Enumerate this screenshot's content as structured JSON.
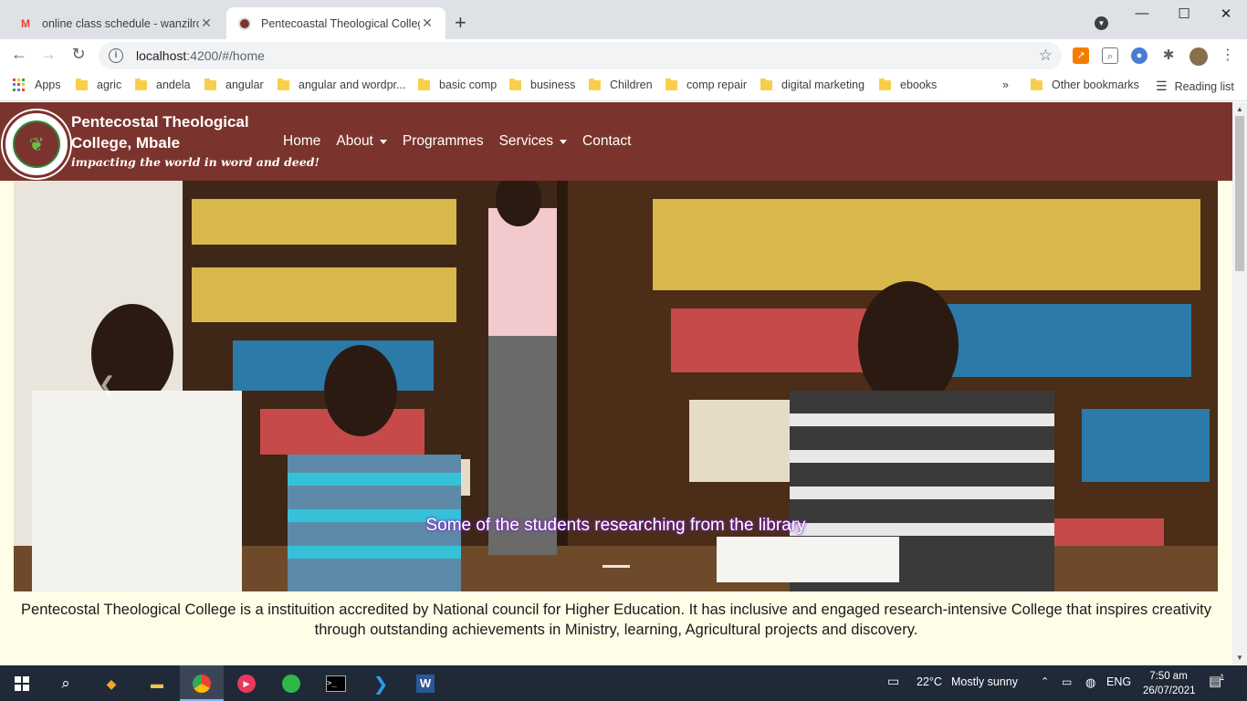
{
  "browser": {
    "tabs": [
      {
        "title": "online class schedule - wanzilro@",
        "favicon": "gmail-icon"
      },
      {
        "title": "Pentecoastal Theological College",
        "favicon": "college-logo-icon"
      }
    ],
    "url_host": "localhost",
    "url_rest": ":4200/#/home"
  },
  "bookmarks": {
    "apps_label": "Apps",
    "items": [
      "agric",
      "andela",
      "angular",
      "angular and wordpr...",
      "basic comp",
      "business",
      "Children",
      "comp repair",
      "digital marketing",
      "ebooks"
    ],
    "overflow": "»",
    "other": "Other bookmarks",
    "reading_list": "Reading list"
  },
  "site": {
    "brand_line1": "Pentecostal Theological",
    "brand_line2": "College, Mbale",
    "tagline": "impacting the world in word and deed!",
    "nav": {
      "home": "Home",
      "about": "About",
      "programmes": "Programmes",
      "services": "Services",
      "contact": "Contact"
    },
    "hero_caption": "Some of the students researching from the library",
    "intro": "Pentecostal Theological College is a instituition accredited by National council for Higher Education. It has inclusive and engaged research-intensive College that inspires creativity through outstanding achievements in Ministry, learning, Agricultural projects and discovery."
  },
  "taskbar": {
    "weather_temp": "22°C",
    "weather_text": "Mostly sunny",
    "language": "ENG",
    "time": "7:50 am",
    "date": "26/07/2021",
    "notification_count": "1"
  }
}
